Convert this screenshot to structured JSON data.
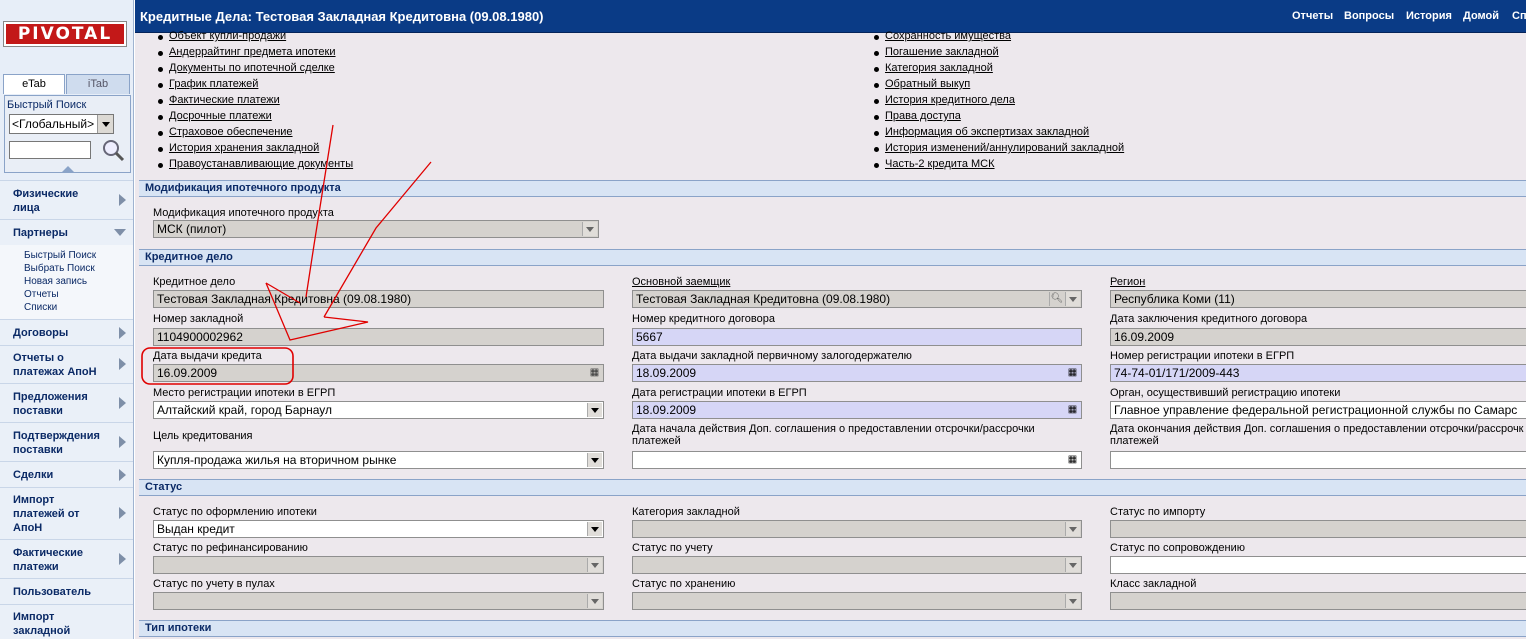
{
  "app": {
    "logo": "PIVOTAL"
  },
  "sidebar": {
    "tabs": [
      "eTab",
      "iTab"
    ],
    "quick_search": {
      "title": "Быстрый Поиск",
      "scope": "<Глобальный>",
      "query": ""
    },
    "nav": [
      {
        "label": "Физические лица"
      },
      {
        "label": "Партнеры",
        "expanded": true,
        "items": [
          "Быстрый Поиск",
          "Выбрать Поиск",
          "Новая запись",
          "Отчеты",
          "Списки"
        ]
      },
      {
        "label": "Договоры"
      },
      {
        "label": "Отчеты о платежах АпоН"
      },
      {
        "label": "Предложения поставки"
      },
      {
        "label": "Подтверждения поставки"
      },
      {
        "label": "Сделки"
      },
      {
        "label": "Импорт платежей от АпоН"
      },
      {
        "label": "Фактические платежи"
      },
      {
        "label": "Пользователь"
      },
      {
        "label": "Импорт закладной"
      }
    ]
  },
  "header": {
    "title": "Кредитные Дела: Тестовая Закладная Кредитовна (09.08.1980)",
    "links": [
      "Отчеты",
      "Вопросы",
      "История",
      "Домой",
      "Сп"
    ]
  },
  "links_left": [
    "Объект купли-продажи",
    "Андеррайтинг предмета ипотеки",
    "Документы по ипотечной сделке",
    "График платежей",
    "Фактические платежи",
    "Досрочные платежи",
    "Страховое обеспечение",
    "История хранения закладной",
    "Правоустанавливающие документы"
  ],
  "links_right": [
    "Сохранность имущества",
    "Погашение закладной",
    "Категория закладной",
    "Обратный выкуп",
    "История кредитного дела",
    "Права доступа",
    "Информация об экспертизах закладной",
    "История изменений/аннулирований закладной",
    "Часть-2 кредита МСК"
  ],
  "sections": {
    "modification": {
      "title": "Модификация ипотечного продукта",
      "field_label": "Модификация ипотечного продукта",
      "field_value": "МСК (пилот)"
    },
    "credit_case": {
      "title": "Кредитное дело",
      "credit_case_label": "Кредитное дело",
      "credit_case_value": "Тестовая Закладная Кредитовна (09.08.1980)",
      "main_borrower_label": "Основной заемщик",
      "main_borrower_value": "Тестовая Закладная Кредитовна (09.08.1980)",
      "region_label": "Регион",
      "region_value": "Республика Коми (11)",
      "mortgage_number_label": "Номер закладной",
      "mortgage_number_value": "1104900002962",
      "contract_number_label": "Номер кредитного договора",
      "contract_number_value": "5667",
      "contract_date_label": "Дата заключения кредитного договора",
      "contract_date_value": "16.09.2009",
      "issue_date_label": "Дата выдачи кредита",
      "issue_date_value": "16.09.2009",
      "pledge_issue_label": "Дата выдачи закладной первичному залогодержателю",
      "pledge_issue_value": "18.09.2009",
      "egrp_number_label": "Номер регистрации ипотеки в ЕГРП",
      "egrp_number_value": "74-74-01/171/2009-443",
      "egrp_place_label": "Место регистрации ипотеки в ЕГРП",
      "egrp_place_value": "Алтайский край, город Барнаул",
      "egrp_date_label": "Дата регистрации ипотеки в ЕГРП",
      "egrp_date_value": "18.09.2009",
      "egrp_org_label": "Орган, осуществивший регистрацию ипотеки",
      "egrp_org_value": "Главное управление федеральной регистрационной службы по Самарс",
      "purpose_label": "Цель кредитования",
      "purpose_value": "Купля-продажа жилья на вторичном рынке",
      "deferral_start_label": "Дата начала действия Доп. соглашения о предоставлении отсрочки/рассрочки платежей",
      "deferral_start_value": "",
      "deferral_end_label": "Дата окончания действия Доп. соглашения о предоставлении отсрочки/рассрочк платежей",
      "deferral_end_value": ""
    },
    "status": {
      "title": "Статус",
      "registration_status_label": "Статус по оформлению ипотеки",
      "registration_status_value": "Выдан кредит",
      "mortgage_category_label": "Категория закладной",
      "import_status_label": "Статус по импорту",
      "refinancing_status_label": "Статус по рефинансированию",
      "accounting_status_label": "Статус по учету",
      "support_status_label": "Статус по сопровождению",
      "pool_status_label": "Статус по учету в пулах",
      "storage_status_label": "Статус по хранению",
      "mortgage_class_label": "Класс закладной"
    },
    "mortgage_type": {
      "title": "Тип ипотеки"
    }
  },
  "colors": {
    "header": "#0a3b86",
    "logo": "#c31818",
    "annotation": "#e00000",
    "required_field": "#d6d6f6"
  },
  "icons": [
    "search-icon",
    "calendar-icon",
    "dropdown-arrow-icon",
    "magnifier-icon"
  ]
}
